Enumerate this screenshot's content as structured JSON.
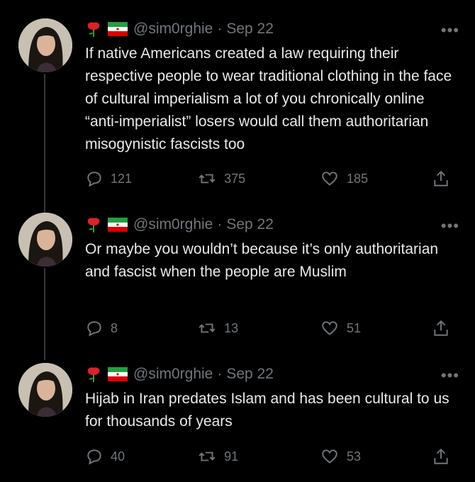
{
  "colors": {
    "background": "#000000",
    "text": "#e7e9ea",
    "muted": "#71767b",
    "thread_line": "#333639"
  },
  "tweets": [
    {
      "emoji": [
        "rose-icon",
        "iran-flag-icon"
      ],
      "handle": "@sim0rghie",
      "separator": "·",
      "date": "Sep 22",
      "more": "•••",
      "text": "If native Americans created a law requiring their respective people to wear traditional clothing in the face of cultural imperialism a lot of you chronically online “anti-imperialist” losers would call them authoritarian misogynistic fascists too",
      "replies": "121",
      "retweets": "375",
      "likes": "185"
    },
    {
      "emoji": [
        "rose-icon",
        "iran-flag-icon"
      ],
      "handle": "@sim0rghie",
      "separator": "·",
      "date": "Sep 22",
      "more": "•••",
      "text": "Or maybe you wouldn’t because it’s only authoritarian and fascist when the people are Muslim",
      "replies": "8",
      "retweets": "13",
      "likes": "51"
    },
    {
      "emoji": [
        "rose-icon",
        "iran-flag-icon"
      ],
      "handle": "@sim0rghie",
      "separator": "·",
      "date": "Sep 22",
      "more": "•••",
      "text": "Hijab in Iran predates Islam and has been cultural to us for thousands of years",
      "replies": "40",
      "retweets": "91",
      "likes": "53"
    }
  ]
}
